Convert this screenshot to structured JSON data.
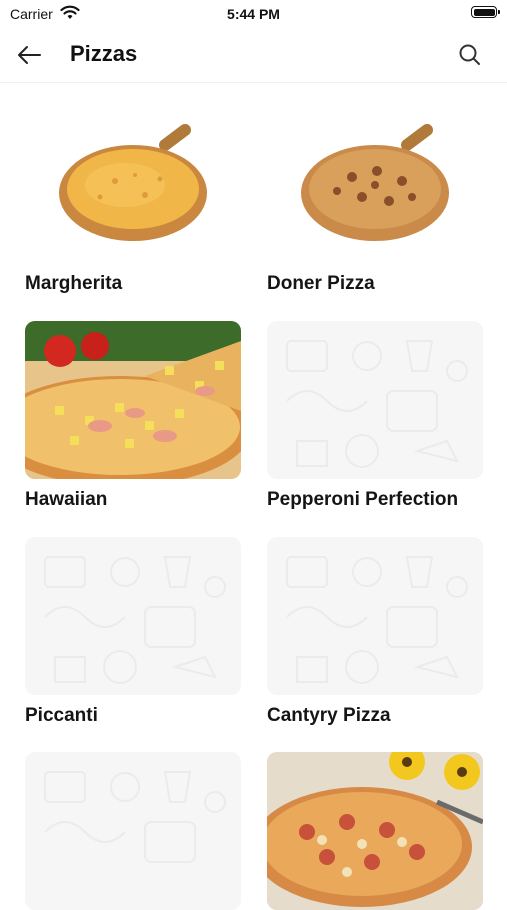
{
  "status_bar": {
    "carrier": "Carrier",
    "time": "5:44 PM"
  },
  "header": {
    "title": "Pizzas",
    "back_icon": "arrow-left-icon",
    "search_icon": "search-icon"
  },
  "products": [
    {
      "name": "Margherita",
      "image": "pizza-cheese"
    },
    {
      "name": "Doner Pizza",
      "image": "pizza-meat"
    },
    {
      "name": "Hawaiian",
      "image": "pizza-hawaiian-photo"
    },
    {
      "name": "Pepperoni Perfection",
      "image": "placeholder-pattern"
    },
    {
      "name": "Piccanti",
      "image": "placeholder-pattern"
    },
    {
      "name": "Cantyry Pizza",
      "image": "placeholder-pattern"
    },
    {
      "name": "",
      "image": "placeholder-pattern"
    },
    {
      "name": "",
      "image": "pizza-chicken-photo"
    }
  ],
  "colors": {
    "placeholder_bg": "#f6f6f6",
    "pattern_stroke": "#ebebeb",
    "text": "#151515"
  }
}
